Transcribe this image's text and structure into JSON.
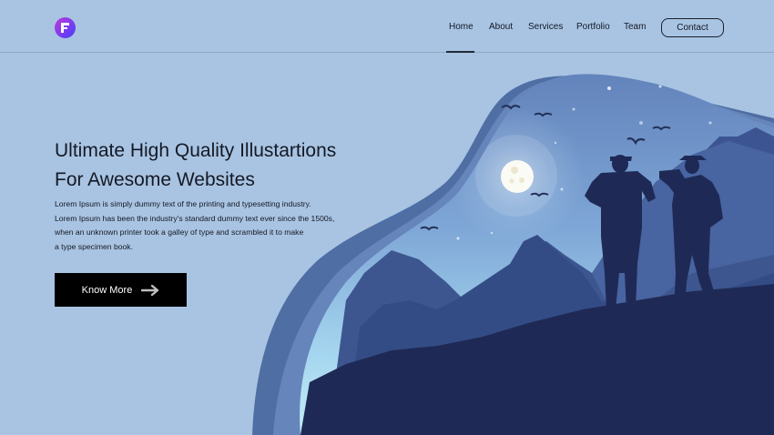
{
  "brand": {
    "logo_letter": "F",
    "logo_icon": "brand-f-icon"
  },
  "nav": {
    "items": [
      "Home",
      "About",
      "Services",
      "Portfolio",
      "Team"
    ],
    "active": "Home",
    "contact_label": "Contact"
  },
  "hero": {
    "title_lines": [
      "Ultimate High Quality Illustartions",
      "For Awesome Websites"
    ],
    "description_lines": [
      "Lorem Ipsum is simply dummy text of the printing and typesetting industry.",
      "Lorem Ipsum has been the industry's standard dummy text ever since the 1500s,",
      "when an unknown printer took a galley of type and scrambled it to make",
      "a type specimen book."
    ],
    "cta_label": "Know More",
    "cta_icon": "arrow-right-icon"
  },
  "colors": {
    "background": "#a9c4e2",
    "logo_gradient": [
      "#c23ad6",
      "#4b3ff5"
    ],
    "cta_background": "#000000",
    "illustration_dark": "#1e2a55"
  }
}
